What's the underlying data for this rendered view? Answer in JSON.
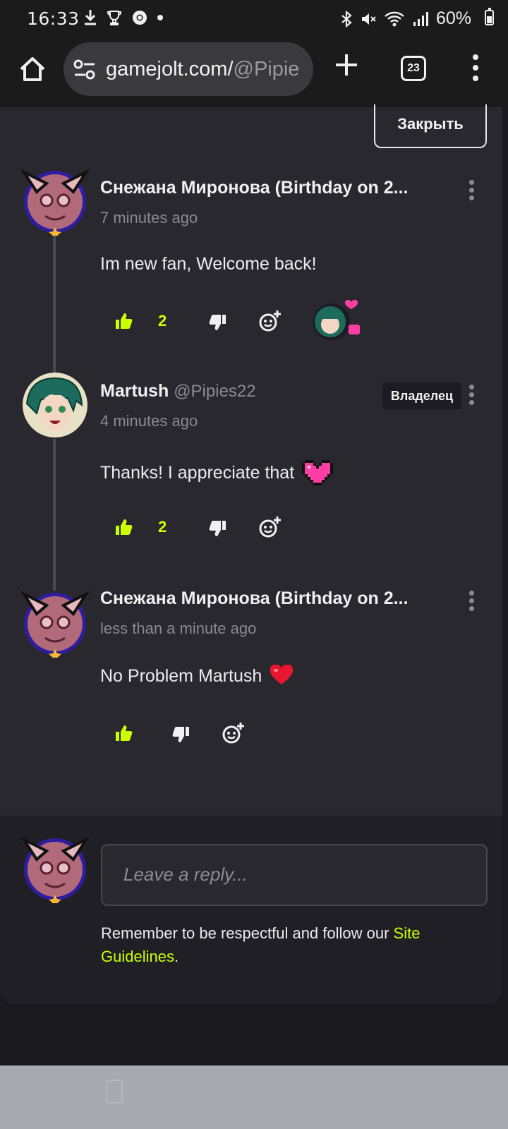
{
  "status_bar": {
    "time": "16:33",
    "battery": "60%",
    "icons_left": [
      "download-icon",
      "trophy-icon",
      "chrome-icon",
      "dot-icon"
    ],
    "icons_right": [
      "bluetooth-icon",
      "mute-icon",
      "wifi-icon",
      "signal-icon",
      "battery-icon"
    ]
  },
  "browser": {
    "url_main": "gamejolt.com/",
    "url_dim": "@Pipie",
    "tab_count": "23"
  },
  "close_button": "Закрыть",
  "comments": [
    {
      "author": "Снежана Миронова (Birthday on 2...",
      "handle": "",
      "time": "7 minutes ago",
      "text": "Im new fan, Welcome back!",
      "likes": "2",
      "has_reaction": true
    },
    {
      "author": "Martush",
      "handle": "@Pipies22",
      "badge": "Владелец",
      "time": "4 minutes ago",
      "text": "Thanks! I appreciate that",
      "likes": "2"
    },
    {
      "author": "Снежана Миронова (Birthday on 2...",
      "handle": "",
      "time": "less than a minute ago",
      "text": "No Problem Martush",
      "likes": ""
    }
  ],
  "reply": {
    "placeholder": "Leave a reply...",
    "note": "Remember to be respectful and follow our ",
    "link": "Site Guidelines",
    "note_end": "."
  },
  "colors": {
    "accent": "#ccff00",
    "panel": "#29282f",
    "heart": "#ff3ea5"
  }
}
